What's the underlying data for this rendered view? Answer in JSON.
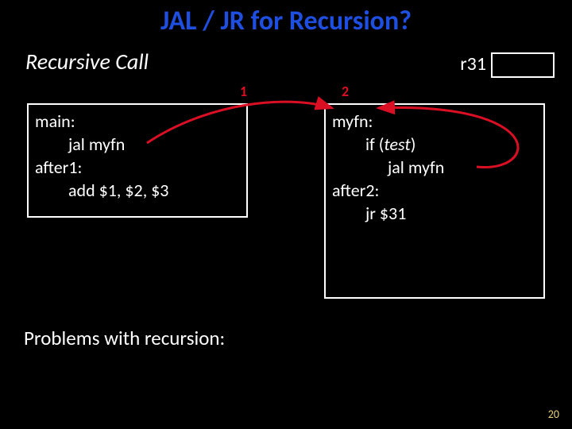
{
  "title": "JAL / JR for Recursion?",
  "subtitle": "Recursive Call",
  "register": {
    "label": "r31"
  },
  "numbers": {
    "n1": "1",
    "n2": "2"
  },
  "left": {
    "l1": "main:",
    "l2": "jal myfn",
    "l3": "after1:",
    "l4": "add $1, $2, $3"
  },
  "right": {
    "l1": "myfn:",
    "l2_pre": "if (",
    "l2_test": "test",
    "l2_post": ")",
    "l3": "jal myfn",
    "l4": "after2:",
    "l5": "jr $31"
  },
  "subhead": "Problems with recursion:",
  "pagenum": "20"
}
